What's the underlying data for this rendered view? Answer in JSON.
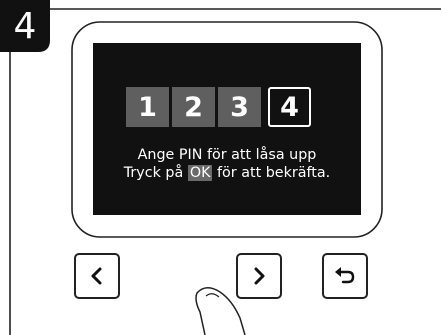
{
  "step": {
    "number": "4"
  },
  "pin": {
    "digits": [
      "1",
      "2",
      "3",
      "4"
    ],
    "active_index": 3
  },
  "screen": {
    "line1": "Ange PIN för att låsa upp",
    "line2_prefix": "Tryck på ",
    "line2_highlight": "OK",
    "line2_suffix": " för att bekräfta."
  },
  "buttons": {
    "left": "chevron-left-icon",
    "right": "chevron-right-icon",
    "back": "back-arrow-icon"
  },
  "colors": {
    "screen_bg": "#111111",
    "digit_bg": "#5f5f5f",
    "highlight_bg": "#6a6a6a",
    "outline": "#222222"
  }
}
